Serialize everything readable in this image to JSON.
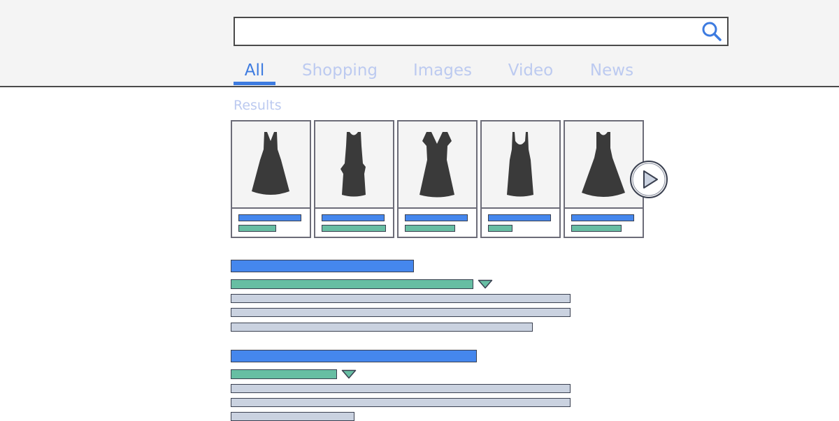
{
  "search": {
    "value": "",
    "button_icon": "search-icon"
  },
  "tabs": [
    {
      "label": "All",
      "active": true
    },
    {
      "label": "Shopping",
      "active": false
    },
    {
      "label": "Images",
      "active": false
    },
    {
      "label": "Video",
      "active": false
    },
    {
      "label": "News",
      "active": false
    }
  ],
  "results_label": "Results",
  "product_cards": [
    {
      "icon": "dress-icon"
    },
    {
      "icon": "dress-icon"
    },
    {
      "icon": "dress-icon"
    },
    {
      "icon": "dress-icon"
    },
    {
      "icon": "dress-icon"
    }
  ],
  "carousel_next_icon": "play-arrow-icon",
  "colors": {
    "accent": "#3d7be0",
    "title_bar": "#4587ed",
    "url_bar": "#67bea3",
    "text_bar": "#cad2e0"
  }
}
